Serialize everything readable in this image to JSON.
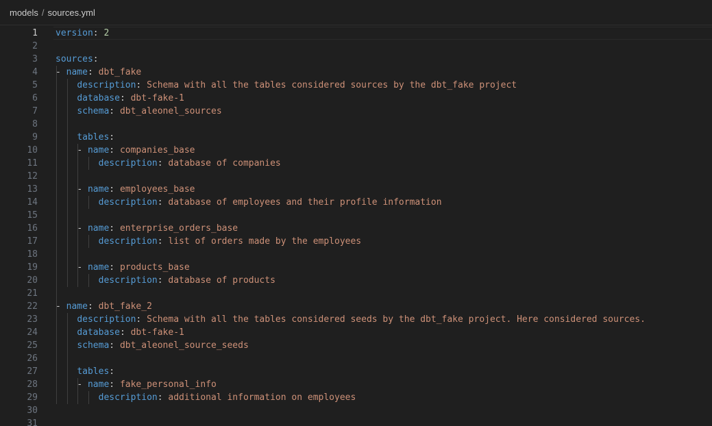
{
  "breadcrumb": {
    "folder": "models",
    "separator": "/",
    "file": "sources.yml"
  },
  "editor": {
    "current_line": 1,
    "colors": {
      "key": "#569cd6",
      "string": "#ce9178",
      "number": "#b5cea8",
      "punctuation": "#cccccc",
      "line_number": "#6e7681",
      "background": "#1f1f1f"
    },
    "lines": [
      {
        "n": 1,
        "indent": 0,
        "dash": false,
        "key": "version",
        "value": "2",
        "vtype": "number",
        "guides": 0
      },
      {
        "n": 2,
        "indent": 0,
        "dash": false,
        "key": "",
        "value": "",
        "vtype": "",
        "guides": 0
      },
      {
        "n": 3,
        "indent": 0,
        "dash": false,
        "key": "sources",
        "value": "",
        "vtype": "",
        "guides": 0
      },
      {
        "n": 4,
        "indent": 2,
        "dash": true,
        "key": "name",
        "value": "dbt_fake",
        "vtype": "string",
        "guides": 1
      },
      {
        "n": 5,
        "indent": 4,
        "dash": false,
        "key": "description",
        "value": "Schema with all the tables considered sources by the dbt_fake project",
        "vtype": "string",
        "guides": 2
      },
      {
        "n": 6,
        "indent": 4,
        "dash": false,
        "key": "database",
        "value": "dbt-fake-1",
        "vtype": "string",
        "guides": 2
      },
      {
        "n": 7,
        "indent": 4,
        "dash": false,
        "key": "schema",
        "value": "dbt_aleonel_sources",
        "vtype": "string",
        "guides": 2
      },
      {
        "n": 8,
        "indent": 0,
        "dash": false,
        "key": "",
        "value": "",
        "vtype": "",
        "guides": 2
      },
      {
        "n": 9,
        "indent": 4,
        "dash": false,
        "key": "tables",
        "value": "",
        "vtype": "",
        "guides": 2
      },
      {
        "n": 10,
        "indent": 6,
        "dash": true,
        "key": "name",
        "value": "companies_base",
        "vtype": "string",
        "guides": 3
      },
      {
        "n": 11,
        "indent": 8,
        "dash": false,
        "key": "description",
        "value": "database of companies",
        "vtype": "string",
        "guides": 4
      },
      {
        "n": 12,
        "indent": 0,
        "dash": false,
        "key": "",
        "value": "",
        "vtype": "",
        "guides": 3
      },
      {
        "n": 13,
        "indent": 6,
        "dash": true,
        "key": "name",
        "value": "employees_base",
        "vtype": "string",
        "guides": 3
      },
      {
        "n": 14,
        "indent": 8,
        "dash": false,
        "key": "description",
        "value": "database of employees and their profile information",
        "vtype": "string",
        "guides": 4
      },
      {
        "n": 15,
        "indent": 0,
        "dash": false,
        "key": "",
        "value": "",
        "vtype": "",
        "guides": 3
      },
      {
        "n": 16,
        "indent": 6,
        "dash": true,
        "key": "name",
        "value": "enterprise_orders_base",
        "vtype": "string",
        "guides": 3
      },
      {
        "n": 17,
        "indent": 8,
        "dash": false,
        "key": "description",
        "value": "list of orders made by the employees",
        "vtype": "string",
        "guides": 4
      },
      {
        "n": 18,
        "indent": 0,
        "dash": false,
        "key": "",
        "value": "",
        "vtype": "",
        "guides": 3
      },
      {
        "n": 19,
        "indent": 6,
        "dash": true,
        "key": "name",
        "value": "products_base",
        "vtype": "string",
        "guides": 3
      },
      {
        "n": 20,
        "indent": 8,
        "dash": false,
        "key": "description",
        "value": "database of products",
        "vtype": "string",
        "guides": 4
      },
      {
        "n": 21,
        "indent": 0,
        "dash": false,
        "key": "",
        "value": "",
        "vtype": "",
        "guides": 1
      },
      {
        "n": 22,
        "indent": 2,
        "dash": true,
        "key": "name",
        "value": "dbt_fake_2",
        "vtype": "string",
        "guides": 1
      },
      {
        "n": 23,
        "indent": 4,
        "dash": false,
        "key": "description",
        "value": "Schema with all the tables considered seeds by the dbt_fake project. Here considered sources.",
        "vtype": "string",
        "guides": 2
      },
      {
        "n": 24,
        "indent": 4,
        "dash": false,
        "key": "database",
        "value": "dbt-fake-1",
        "vtype": "string",
        "guides": 2
      },
      {
        "n": 25,
        "indent": 4,
        "dash": false,
        "key": "schema",
        "value": "dbt_aleonel_source_seeds",
        "vtype": "string",
        "guides": 2
      },
      {
        "n": 26,
        "indent": 0,
        "dash": false,
        "key": "",
        "value": "",
        "vtype": "",
        "guides": 2
      },
      {
        "n": 27,
        "indent": 4,
        "dash": false,
        "key": "tables",
        "value": "",
        "vtype": "",
        "guides": 2
      },
      {
        "n": 28,
        "indent": 6,
        "dash": true,
        "key": "name",
        "value": "fake_personal_info",
        "vtype": "string",
        "guides": 3
      },
      {
        "n": 29,
        "indent": 8,
        "dash": false,
        "key": "description",
        "value": "additional information on employees",
        "vtype": "string",
        "guides": 4
      },
      {
        "n": 30,
        "indent": 0,
        "dash": false,
        "key": "",
        "value": "",
        "vtype": "",
        "guides": 0
      },
      {
        "n": 31,
        "indent": 0,
        "dash": false,
        "key": "",
        "value": "",
        "vtype": "",
        "guides": 0
      }
    ]
  }
}
